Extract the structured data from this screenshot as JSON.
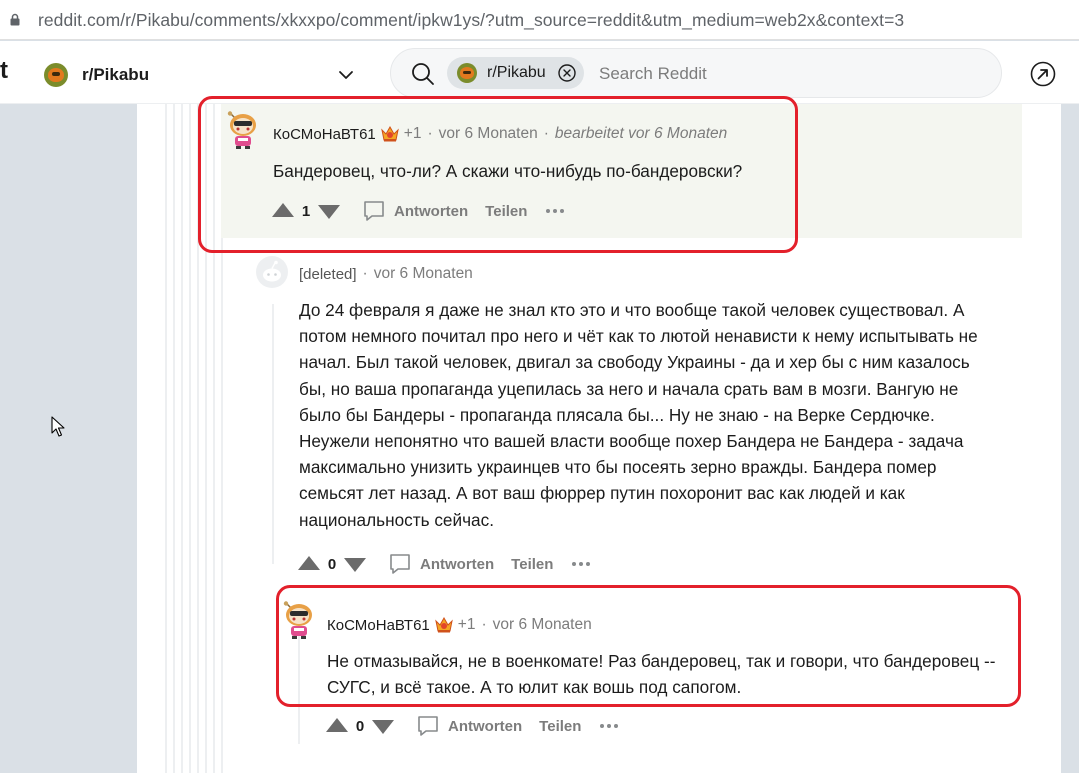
{
  "browser": {
    "url": "reddit.com/r/Pikabu/comments/xkxxpo/comment/ipkw1ys/?utm_source=reddit&utm_medium=web2x&context=3"
  },
  "header": {
    "logo_fragment": "t",
    "community": "r/Pikabu",
    "search_chip": "r/Pikabu",
    "search_placeholder": "Search Reddit"
  },
  "comments": [
    {
      "author": "КоСМоНаВТ61",
      "karma": "+1",
      "time": "vor 6 Monaten",
      "edited": "bearbeitet vor 6 Monaten",
      "body": "Бандеровец, что-ли? А скажи что-нибудь по-бандеровски?",
      "votes": "1",
      "reply_label": "Antworten",
      "share_label": "Teilen"
    },
    {
      "author": "[deleted]",
      "time": "vor 6 Monaten",
      "body": "До 24 февраля я даже не знал кто это и что вообще такой человек существовал. А потом немного почитал про него и чёт как то лютой ненависти к нему испытывать не начал. Был такой человек, двигал за свободу Украины - да и хер бы с ним казалось бы, но ваша пропаганда уцепилась за него и начала срать вам в мозги. Вангую не было бы Бандеры - пропаганда плясала бы... Ну не знаю - на Верке Сердючке. Неужели непонятно что вашей власти вообще похер Бандера не Бандера - задача максимально унизить украинцев что бы посеять зерно вражды. Бандера помер семьсят лет назад. А вот ваш фюррер путин похоронит вас как людей и как национальность сейчас.",
      "votes": "0",
      "reply_label": "Antworten",
      "share_label": "Teilen"
    },
    {
      "author": "КоСМоНаВТ61",
      "karma": "+1",
      "time": "vor 6 Monaten",
      "body": "Не отмазывайся, не в военкомате! Раз бандеровец, так и говори, что бандеровец -- СУГС, и всё такое. А то юлит как вошь под сапогом.",
      "votes": "0",
      "reply_label": "Antworten",
      "share_label": "Teilen"
    }
  ],
  "colors": {
    "annotation": "#e3202b",
    "highlight_bg": "#f4f6f0",
    "page_bg": "#dae0e6",
    "meta_text": "#7c7c7c"
  },
  "icons": [
    "lock-icon",
    "chevron-down-icon",
    "search-icon",
    "close-icon",
    "share-arrow-icon",
    "upvote-icon",
    "downvote-icon",
    "reply-icon",
    "more-icon",
    "cursor-icon"
  ]
}
